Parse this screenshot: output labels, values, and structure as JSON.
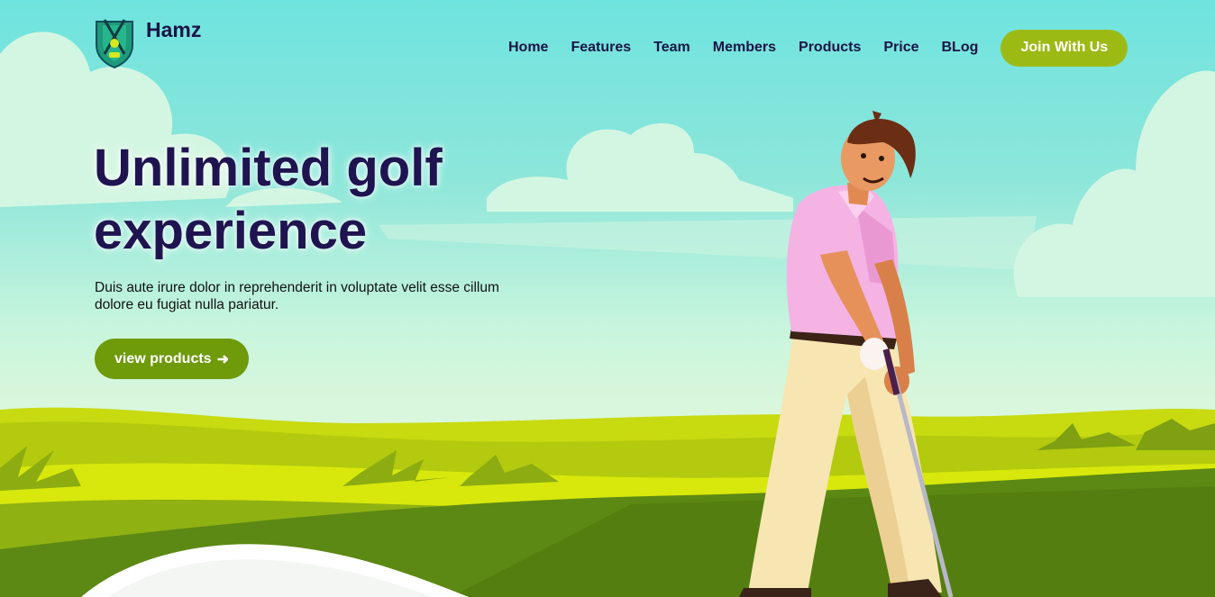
{
  "brand": {
    "name": "Hamz",
    "logo_icon": "golf-shield-icon"
  },
  "nav": {
    "items": [
      {
        "label": "Home"
      },
      {
        "label": "Features"
      },
      {
        "label": "Team"
      },
      {
        "label": "Members"
      },
      {
        "label": "Products"
      },
      {
        "label": "Price"
      },
      {
        "label": "BLog"
      }
    ],
    "join_label": "Join With Us"
  },
  "hero": {
    "title_line1": "Unlimited golf",
    "title_line2": "experience",
    "description": "Duis aute irure dolor in reprehenderit in voluptate velit esse cillum dolore eu fugiat nulla pariatur.",
    "cta_label": "view products",
    "cta_icon": "arrow-right-icon",
    "cta_arrow": "➜"
  },
  "colors": {
    "sky": "#6fe3df",
    "accent_green": "#9cba14",
    "cta_green": "#6f9a0a",
    "title_navy": "#1f1450",
    "grass_dark": "#5a8a12",
    "grass_light": "#c9dc0e"
  }
}
